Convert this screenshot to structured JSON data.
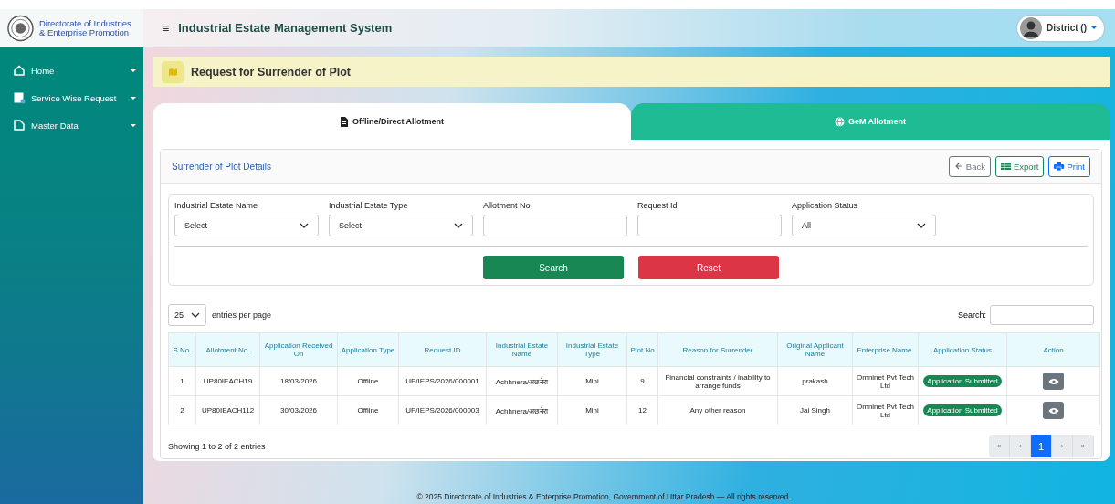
{
  "header": {
    "org_name": "Directorate of Industries & Enterprise Promotion",
    "menu_glyph": "≡",
    "app_title": "Industrial Estate Management System",
    "user": "District ()"
  },
  "sidebar": {
    "items": [
      {
        "label": "Home",
        "kind": "home"
      },
      {
        "label": "Service Wise Request",
        "kind": "request"
      },
      {
        "label": "Master Data",
        "kind": "data"
      }
    ]
  },
  "page_title": "Request for Surrender of Plot",
  "tabs": [
    {
      "label": "Offline/Direct Allotment",
      "kind": "file",
      "selected": true
    },
    {
      "label": "GeM Allotment",
      "kind": "globe",
      "selected": false
    }
  ],
  "panel": {
    "title": "Surrender of Plot Details",
    "buttons": [
      {
        "label": "Back",
        "kind": "back"
      },
      {
        "label": "Export",
        "kind": "export"
      },
      {
        "label": "Print",
        "kind": "print"
      }
    ]
  },
  "filters": [
    {
      "label": "Industrial Estate Name",
      "kind": "select",
      "value": "Select"
    },
    {
      "label": "Industrial Estate Type",
      "kind": "select",
      "value": "Select"
    },
    {
      "label": "Allotment No.",
      "kind": "text"
    },
    {
      "label": "Request Id",
      "kind": "text"
    },
    {
      "label": "Application Status",
      "kind": "select",
      "value": "All"
    }
  ],
  "actions": [
    {
      "label": "Search",
      "kind": "primary"
    },
    {
      "label": "Reset",
      "kind": "danger"
    }
  ],
  "table": {
    "page_size": "25",
    "page_size_label": "entries per page",
    "search_label": "Search:",
    "columns": [
      "S.No.",
      "Allotment No.",
      "Application Received On",
      "Application Type",
      "Request ID",
      "Industrial Estate Name",
      "Industrial Estate Type",
      "Plot No",
      "Reason for Surrender",
      "Original Applicant Name",
      "Enterprise Name.",
      "Application Status",
      "Action"
    ],
    "rows": [
      {
        "cells": [
          "1",
          "UP80IEACH19",
          "18/03/2026",
          "Offline",
          "UP/IEPS/2026/000001",
          "Achhnera/अछनेरा",
          "Mini",
          "9",
          "Financial constraints / inability to arrange funds",
          "prakash",
          "Omninet Pvt Tech Ltd"
        ],
        "status": "Application Submitted"
      },
      {
        "cells": [
          "2",
          "UP80IEACH112",
          "30/03/2026",
          "Offline",
          "UP/IEPS/2026/000003",
          "Achhnera/अछनेरा",
          "Mini",
          "12",
          "Any other reason",
          "Jai Singh",
          "Omninet Pvt Tech Ltd"
        ],
        "status": "Application Submitted"
      }
    ],
    "info": "Showing 1 to 2 of 2 entries",
    "pagination": [
      {
        "label": "«",
        "selected": false
      },
      {
        "label": "‹",
        "selected": false
      },
      {
        "label": "1",
        "selected": true
      },
      {
        "label": "›",
        "selected": false
      },
      {
        "label": "»",
        "selected": false
      }
    ]
  },
  "footer": "© 2025 Directorate of Industries & Enterprise Promotion, Government of Uttar Pradesh — All rights reserved."
}
